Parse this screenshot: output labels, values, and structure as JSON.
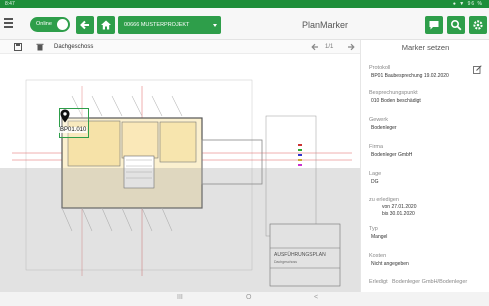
{
  "status_bar": {
    "time": "8:47",
    "system_icons": "● ▼ 96 %"
  },
  "app": {
    "title": "PlanMarker",
    "online_label": "Online",
    "project": "00666 MUSTERPROJEKT",
    "icons": {
      "menu": "menu-icon",
      "back": "arrow-back-icon",
      "home": "home-icon",
      "chat": "chat-icon",
      "search": "search-icon",
      "settings": "gear-icon"
    }
  },
  "toolbar": {
    "floor": "Dachgeschoss",
    "page": "1/1"
  },
  "marker": {
    "label": "BP01.010"
  },
  "panel": {
    "title": "Marker setzen",
    "fields": [
      {
        "label": "Protokoll",
        "value": "BP01 Baubesprechung 19.02.2020"
      },
      {
        "label": "Besprechungspunkt",
        "value": "010 Boden beschädigt"
      },
      {
        "label": "Gewerk",
        "value": "Bodenleger"
      },
      {
        "label": "Firma",
        "value": "Bodenleger GmbH"
      },
      {
        "label": "Lage",
        "value": "DG"
      },
      {
        "label": "zu erledigen",
        "value": "von 27.01.2020",
        "value2": "bis 30.01.2020"
      },
      {
        "label": "Typ",
        "value": "Mangel"
      },
      {
        "label": "Kosten",
        "value": "Nicht angegeben"
      },
      {
        "label": "Erledigt",
        "value": "Bodenleger GmbH/Bodenleger"
      }
    ]
  },
  "plan": {
    "title_block": "AUSFÜHRUNGSPLAN",
    "title_block_sub": "Dachgeschoss"
  },
  "nav": {
    "recents": "III",
    "home": "O",
    "back": "<"
  },
  "colors": {
    "brand": "#2e9e4a",
    "status": "#1e8e3a"
  }
}
